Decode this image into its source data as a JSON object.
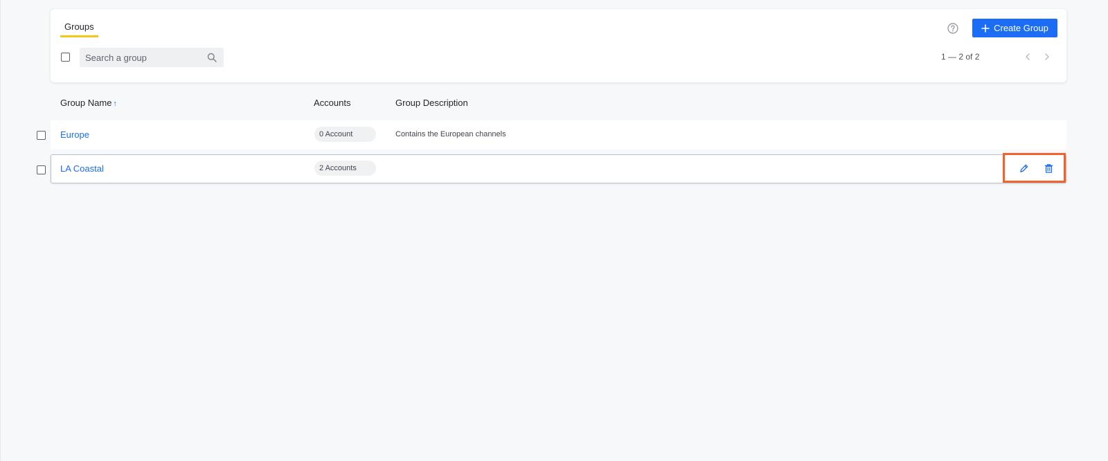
{
  "header": {
    "tab_label": "Groups",
    "create_button_label": "Create Group",
    "search_placeholder": "Search a group",
    "pagination": "1 — 2 of 2",
    "help_icon": "question-circle-icon"
  },
  "table": {
    "columns": {
      "name": "Group Name",
      "name_sort": "↑",
      "accounts": "Accounts",
      "description": "Group Description"
    },
    "rows": [
      {
        "name": "Europe",
        "accounts": "0 Account",
        "description": "Contains the European channels"
      },
      {
        "name": "LA Coastal",
        "accounts": "2 Accounts",
        "description": ""
      }
    ],
    "row_actions": {
      "edit_icon": "pencil-icon",
      "delete_icon": "trash-icon"
    }
  },
  "colors": {
    "accent": "#1b6ef3",
    "tab_underline": "#f5c518",
    "highlight": "#f4622b"
  }
}
